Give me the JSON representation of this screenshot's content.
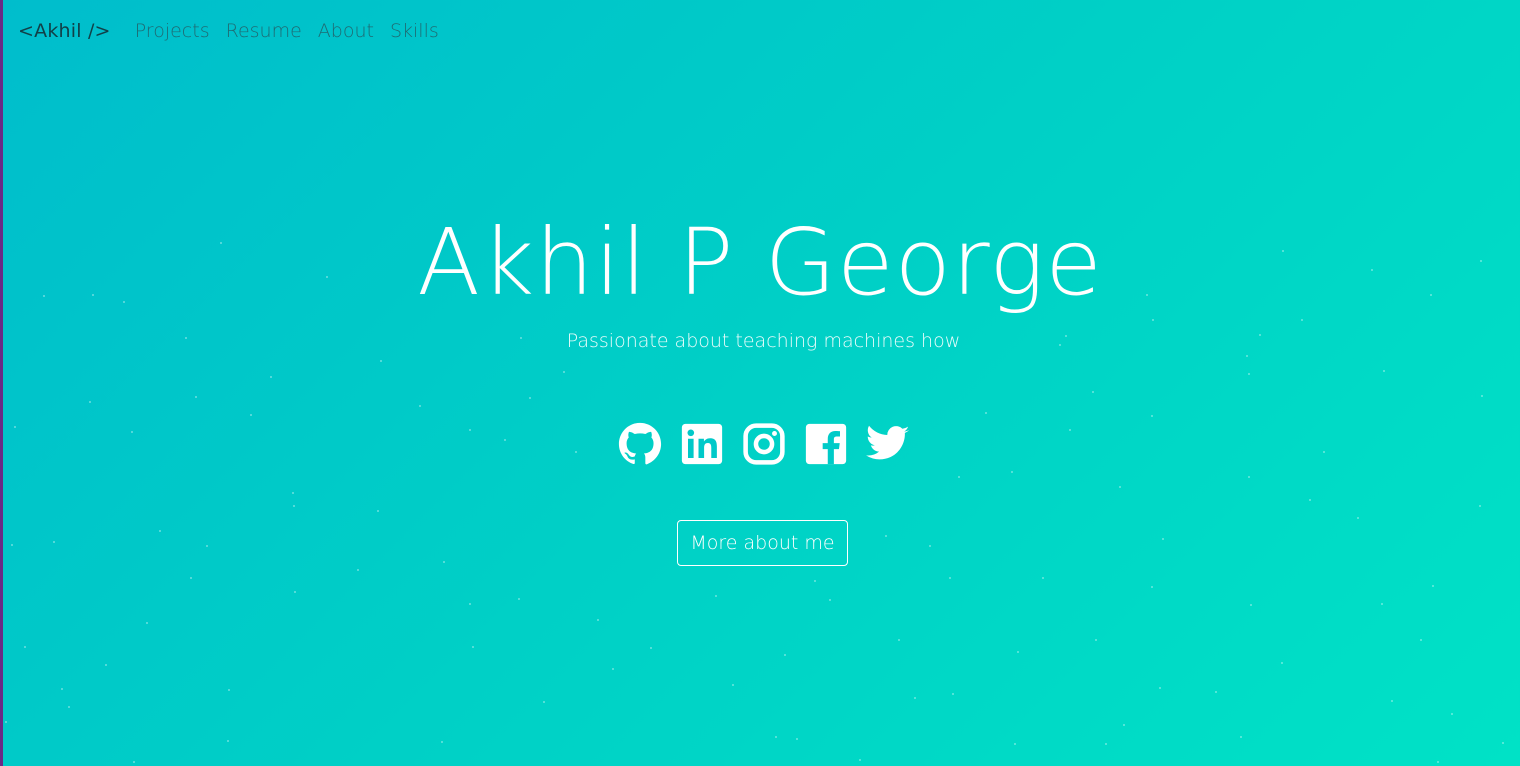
{
  "nav": {
    "brand": "<Akhil />",
    "links": [
      "Projects",
      "Resume",
      "About",
      "Skills"
    ]
  },
  "hero": {
    "name": "Akhil P George",
    "tagline": "Passionate about teaching machines how",
    "cta_label": "More about me"
  },
  "social_icons": [
    "github-icon",
    "linkedin-icon",
    "instagram-icon",
    "facebook-icon",
    "twitter-icon"
  ],
  "colors": {
    "gradient_start": "#00bdcc",
    "gradient_end": "#00e2c6",
    "text": "#ffffff",
    "brand": "#114048",
    "nav_link": "#1f6b73",
    "left_edge": "#6a2a86"
  }
}
